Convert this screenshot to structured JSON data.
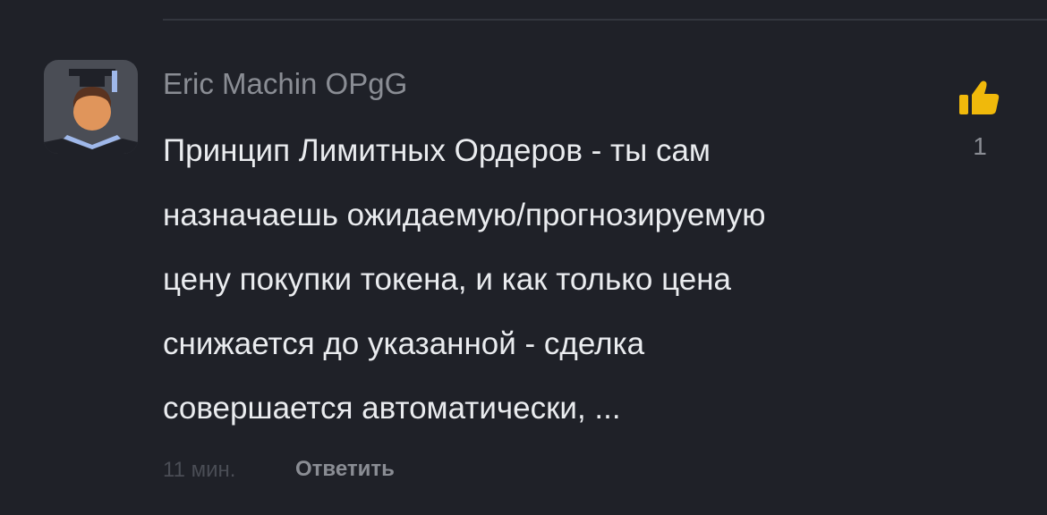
{
  "comment": {
    "author": "Eric Machin OPgG",
    "avatar_icon": "graduate-avatar-icon",
    "text": "Принцип Лимитных Ордеров - ты сам\nназначаешь ожидаемую/прогнозируемую\nцену покупки токена, и как только цена\nснижается до указанной - сделка\nсовершается автоматически, ...",
    "time": "11 мин.",
    "reply_label": "Ответить",
    "like_icon": "thumbs-up-icon",
    "like_count": "1"
  },
  "colors": {
    "background": "#1f2128",
    "accent": "#f0b90b",
    "text_primary": "#eaecef",
    "text_secondary": "#8a8d94"
  }
}
